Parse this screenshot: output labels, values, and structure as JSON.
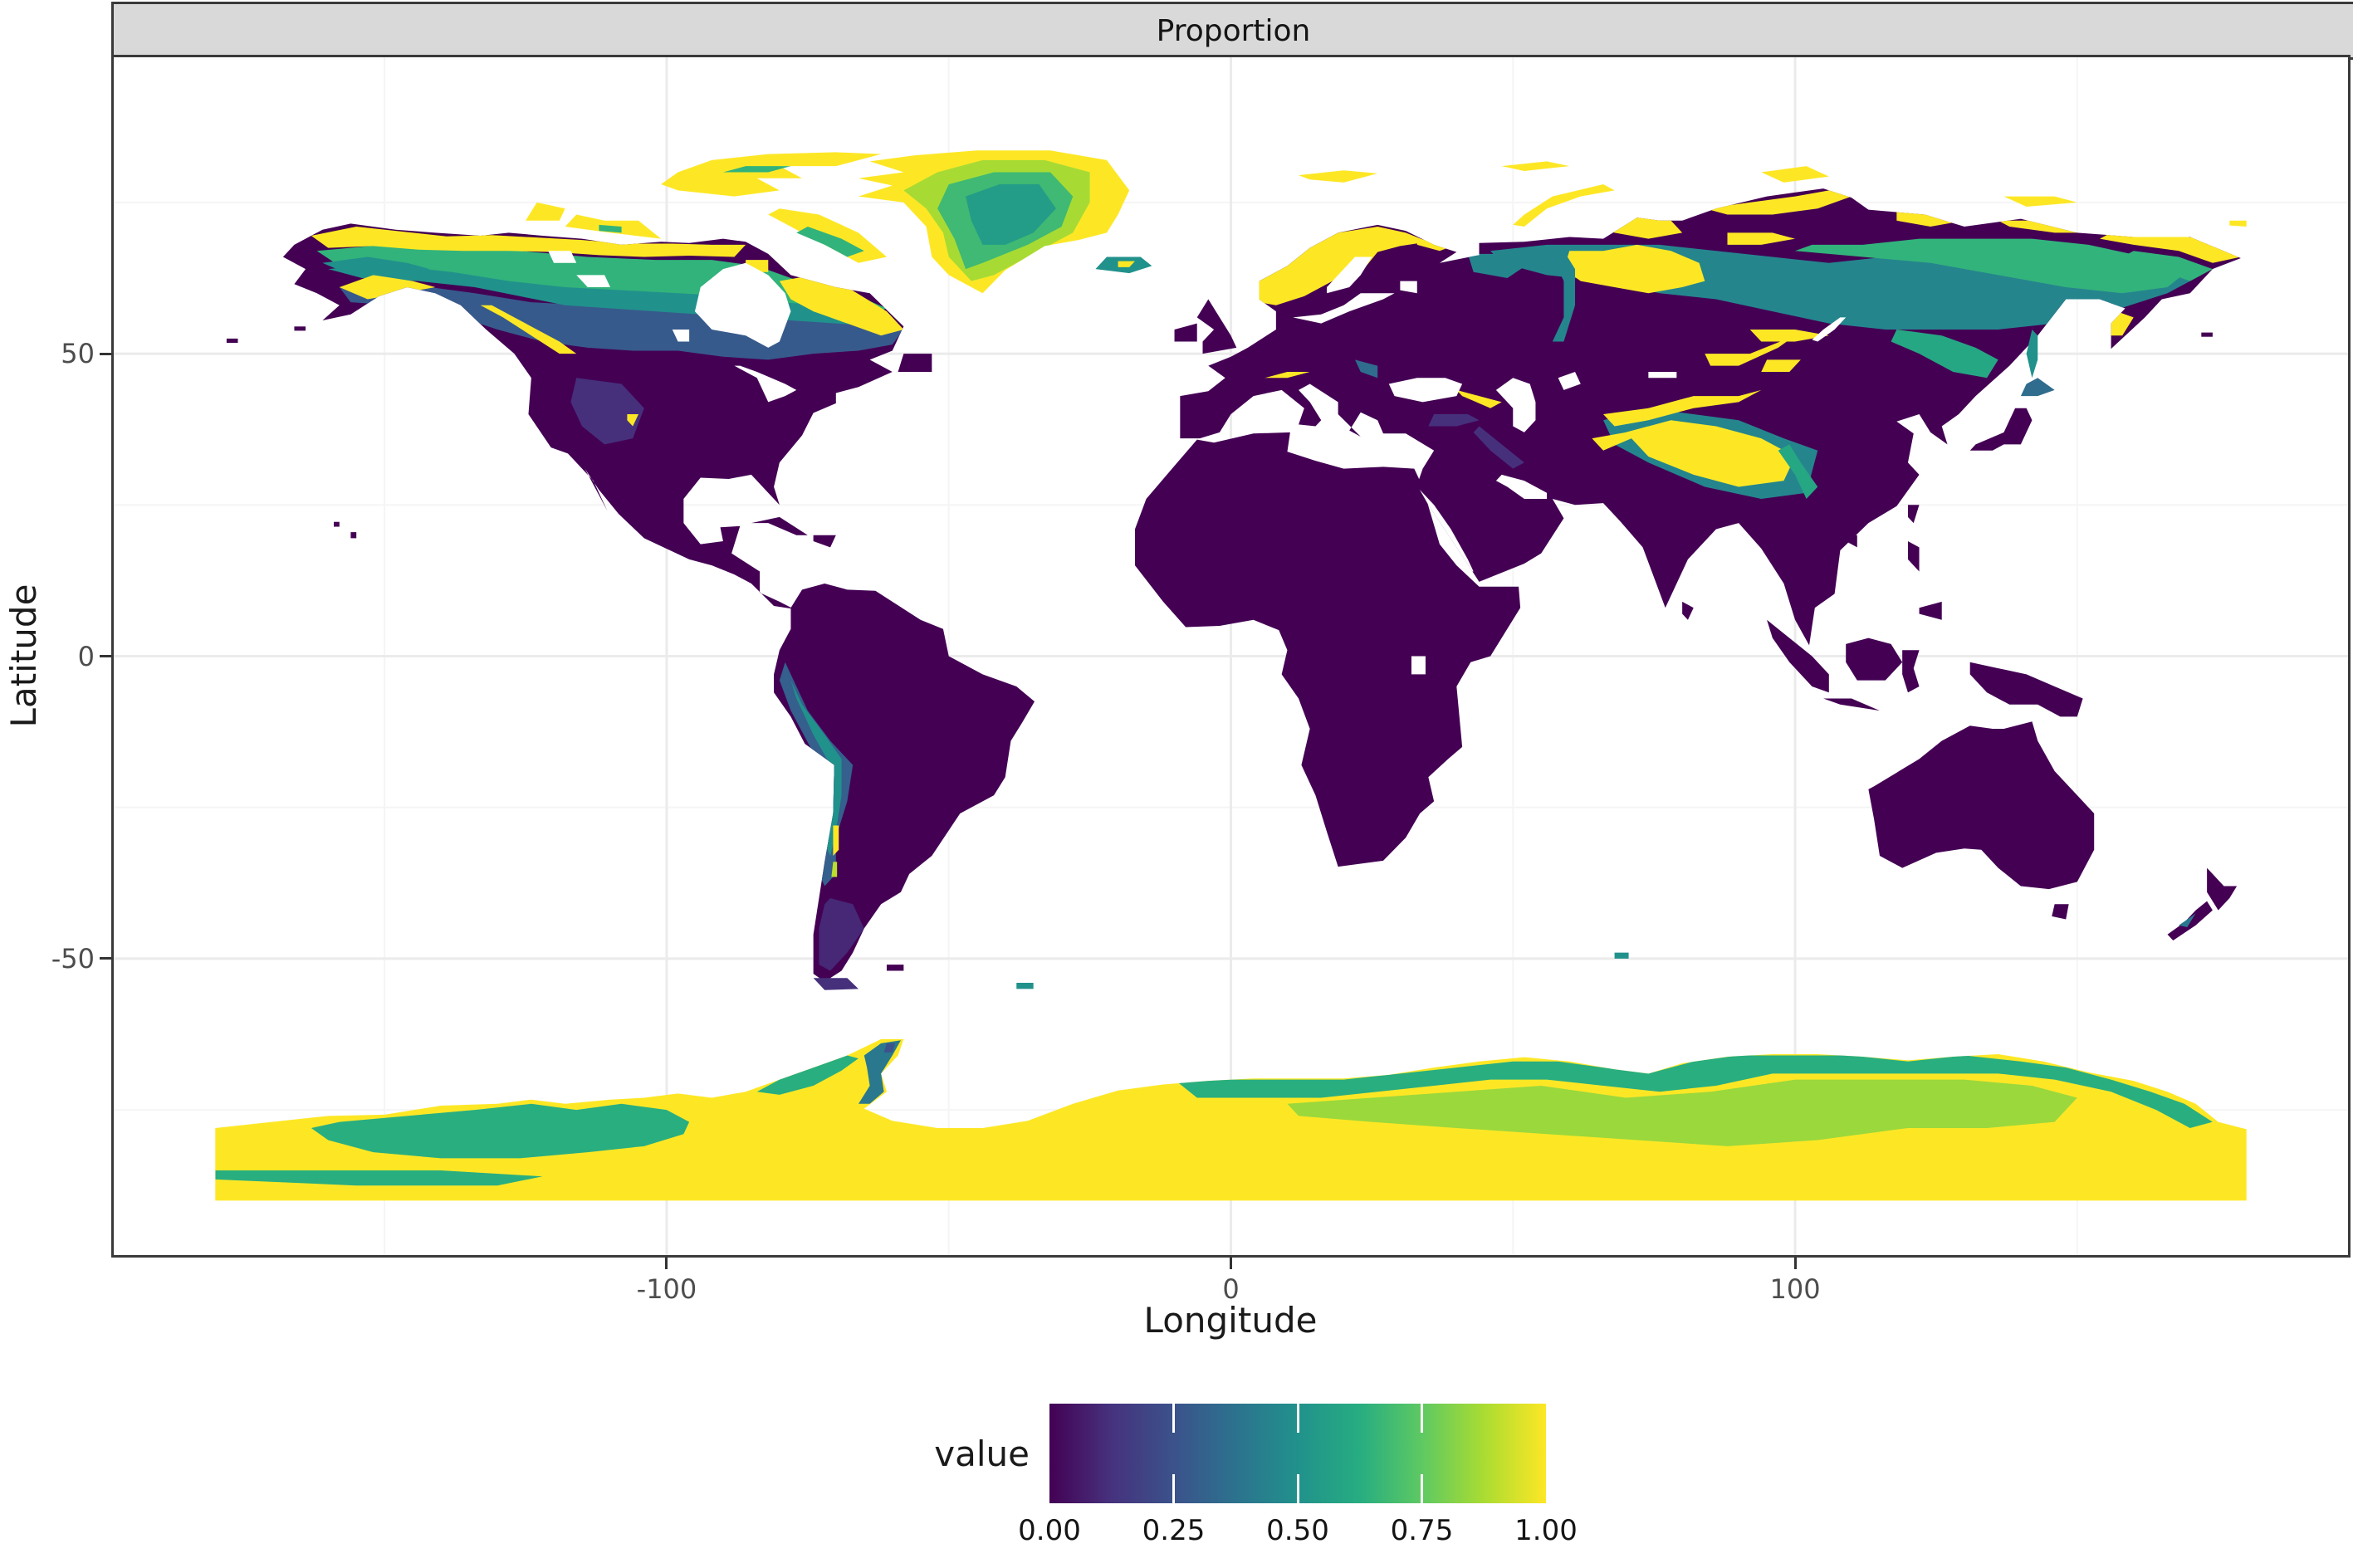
{
  "strip": {
    "title": "Proportion"
  },
  "axes": {
    "x": {
      "title": "Longitude",
      "tick_labels": [
        "-100",
        "0",
        "100"
      ],
      "tick_values": [
        -100,
        0,
        100
      ],
      "minor_values": [
        -150,
        -50,
        50,
        150
      ],
      "panel_range": [
        -198,
        198
      ]
    },
    "y": {
      "title": "Latitude",
      "tick_labels": [
        "50",
        "0",
        "-50"
      ],
      "tick_values": [
        50,
        0,
        -50
      ],
      "minor_values": [
        75,
        25,
        -25,
        -75
      ],
      "panel_range": [
        -99,
        99
      ]
    }
  },
  "legend": {
    "title": "value",
    "tick_labels": [
      "0.00",
      "0.25",
      "0.50",
      "0.75",
      "1.00"
    ],
    "tick_fractions": [
      0,
      0.25,
      0.5,
      0.75,
      1
    ],
    "bar_tick_fractions": [
      0.25,
      0.5,
      0.75
    ],
    "colormap": "viridis",
    "gradient_stops": [
      "#440154",
      "#46327e",
      "#3b528b",
      "#2c728e",
      "#21918c",
      "#27ad81",
      "#5ec962",
      "#aadc32",
      "#fde725"
    ]
  },
  "colors": {
    "strip_bg": "#d9d9d9",
    "strip_border": "#3a3a3a",
    "panel_border": "#3a3a3a",
    "panel_bg": "#ffffff",
    "grid_major": "#ebebeb",
    "grid_minor": "#f5f5f5",
    "axis_text": "#4d4d4d",
    "title_text": "#1a1a1a",
    "water_no_data": "#ffffff"
  },
  "chart_data": {
    "type": "heatmap",
    "subtype": "world raster map, equirectangular lon/lat grid",
    "facet_title": "Proportion",
    "xlabel": "Longitude",
    "ylabel": "Latitude",
    "x_ticks": [
      -100,
      0,
      100
    ],
    "y_ticks": [
      50,
      0,
      -50
    ],
    "data_xlim": [
      -180,
      180
    ],
    "data_ylim": [
      -90,
      90
    ],
    "value_range": [
      0,
      1
    ],
    "legend_title": "value",
    "legend_ticks": [
      0,
      0.25,
      0.5,
      0.75,
      1
    ],
    "colormap": "viridis",
    "grid": true,
    "water_shown_as": "white (no data)",
    "regions": [
      {
        "region": "Tropical and temperate lowlands (Africa, South America, Australia, southern Eurasia, contiguous US, Europe)",
        "approx_value": 0.0
      },
      {
        "region": "US Rocky Mountains interior patch",
        "approx_value": 0.12
      },
      {
        "region": "Patagonia",
        "approx_value": 0.12
      },
      {
        "region": "Southern boreal transition belt Canada and Russia (~50-58N)",
        "approx_value": 0.3
      },
      {
        "region": "Mid boreal belt Canada and Siberia (~55-65N)",
        "approx_value": 0.5
      },
      {
        "region": "Northern taiga-tundra belt (~60-68N)",
        "approx_value": 0.65
      },
      {
        "region": "Arctic tundra coasts and archipelagos (>68N)",
        "approx_value": 1.0
      },
      {
        "region": "West Siberian Plain wetlands",
        "approx_value": 1.0
      },
      {
        "region": "Fennoscandia (Norway, northern Sweden/Finland)",
        "approx_value": 1.0
      },
      {
        "region": "Greenland coastal margin",
        "approx_value": 1.0
      },
      {
        "region": "Greenland interior ice sheet",
        "approx_value": 0.55
      },
      {
        "region": "Iceland",
        "approx_value": 0.5
      },
      {
        "region": "Tibetan Plateau and Himalaya",
        "approx_value": 1.0
      },
      {
        "region": "Tian Shan, Pamir, Altai, Sayan mountains",
        "approx_value": 1.0
      },
      {
        "region": "Central Chilean Andes",
        "approx_value": 1.0
      },
      {
        "region": "Andes flanks (Peru-Bolivia-Chile)",
        "approx_value": 0.4
      },
      {
        "region": "Antarctica interior and far-south band",
        "approx_value": 1.0
      },
      {
        "region": "East Antarctic coast, Marie Byrd Land, Antarctic Peninsula",
        "approx_value": 0.6
      },
      {
        "region": "East Antarctic high plateau",
        "approx_value": 0.85
      },
      {
        "region": "Oceans, large lakes, Hudson Bay, Caspian/Black/Baltic seas",
        "approx_value": null
      }
    ]
  }
}
